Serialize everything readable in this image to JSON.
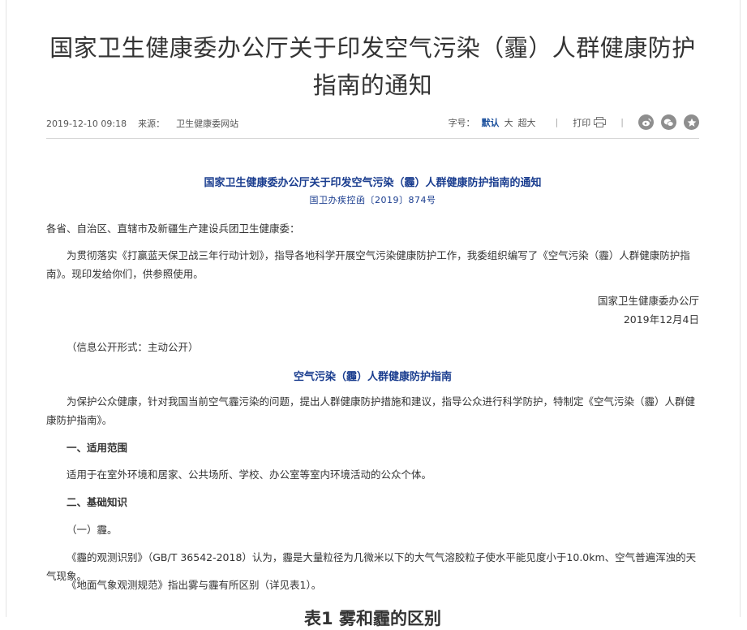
{
  "article": {
    "title": "国家卫生健康委办公厅关于印发空气污染（霾）人群健康防护指南的通知",
    "date": "2019-12-10 09:18",
    "source_label": "来源：",
    "source": "卫生健康委网站"
  },
  "toolbar": {
    "font_label": "字号：",
    "font_default": "默认",
    "font_large": "大",
    "font_xlarge": "超大",
    "separator": "|",
    "print_label": "打印"
  },
  "share": {
    "icons": [
      "weibo-icon",
      "wechat-icon",
      "favorite-icon"
    ]
  },
  "doc": {
    "header": "国家卫生健康委办公厅关于印发空气污染（霾）人群健康防护指南的通知",
    "number": "国卫办疾控函〔2019〕874号",
    "addressee": "各省、自治区、直辖市及新疆生产建设兵团卫生健康委：",
    "body1": "为贯彻落实《打赢蓝天保卫战三年行动计划》，指导各地科学开展空气污染健康防护工作，我委组织编写了《空气污染（霾）人群健康防护指南》。现印发给你们，供参照使用。",
    "signature": "国家卫生健康委办公厅",
    "sign_date": "2019年12月4日",
    "disclosure": "（信息公开形式：主动公开）",
    "guide_title": "空气污染（霾）人群健康防护指南",
    "guide_intro": "为保护公众健康，针对我国当前空气霾污染的问题，提出人群健康防护措施和建议，指导公众进行科学防护，特制定《空气污染（霾）人群健康防护指南》。",
    "sec1_title": "一、适用范围",
    "sec1_body": "适用于在室外环境和居家、公共场所、学校、办公室等室内环境活动的公众个体。",
    "sec2_title": "二、基础知识",
    "sec2_sub1": "（一）霾。",
    "sec2_p1": "《霾的观测识别》（GB/T 36542-2018）认为，霾是大量粒径为几微米以下的大气气溶胶粒子使水平能见度小于10.0km、空气普遍浑浊的天气现象。",
    "sec2_p2": "《地面气象观测规范》指出雾与霾有所区别（详见表1）。",
    "table1_title": "表1 雾和霾的区别"
  }
}
